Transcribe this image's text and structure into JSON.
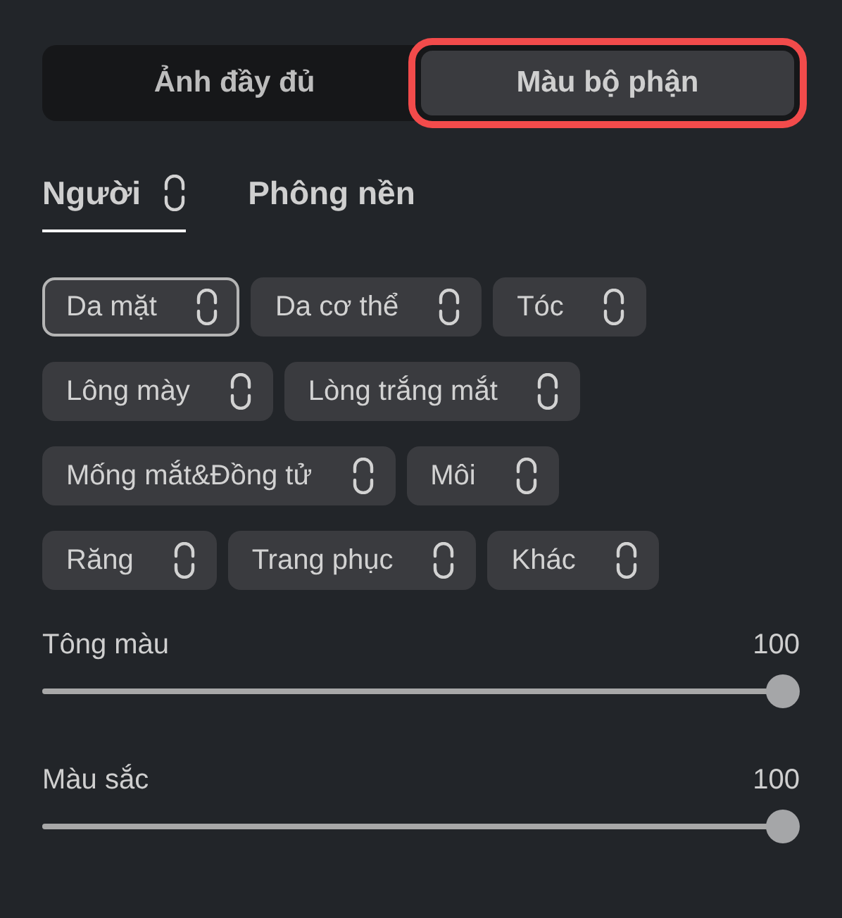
{
  "mode_tabs": [
    {
      "label": "Ảnh đầy đủ",
      "selected": false,
      "highlighted": false
    },
    {
      "label": "Màu bộ phận",
      "selected": true,
      "highlighted": true
    }
  ],
  "subject_tabs": [
    {
      "label": "Người",
      "selected": true,
      "has_icon": true
    },
    {
      "label": "Phông nền",
      "selected": false,
      "has_icon": false
    }
  ],
  "part_rows": [
    [
      {
        "label": "Da mặt",
        "selected": true
      },
      {
        "label": "Da cơ thể",
        "selected": false
      },
      {
        "label": "Tóc",
        "selected": false
      }
    ],
    [
      {
        "label": "Lông mày",
        "selected": false
      },
      {
        "label": "Lòng trắng mắt",
        "selected": false
      }
    ],
    [
      {
        "label": "Mống mắt&Đồng tử",
        "selected": false
      },
      {
        "label": "Môi",
        "selected": false
      }
    ],
    [
      {
        "label": "Răng",
        "selected": false
      },
      {
        "label": "Trang phục",
        "selected": false
      },
      {
        "label": "Khác",
        "selected": false
      }
    ]
  ],
  "sliders": [
    {
      "label": "Tông màu",
      "reading": "100",
      "level": 1
    },
    {
      "label": "Màu sắc",
      "reading": "100",
      "level": 1
    }
  ]
}
